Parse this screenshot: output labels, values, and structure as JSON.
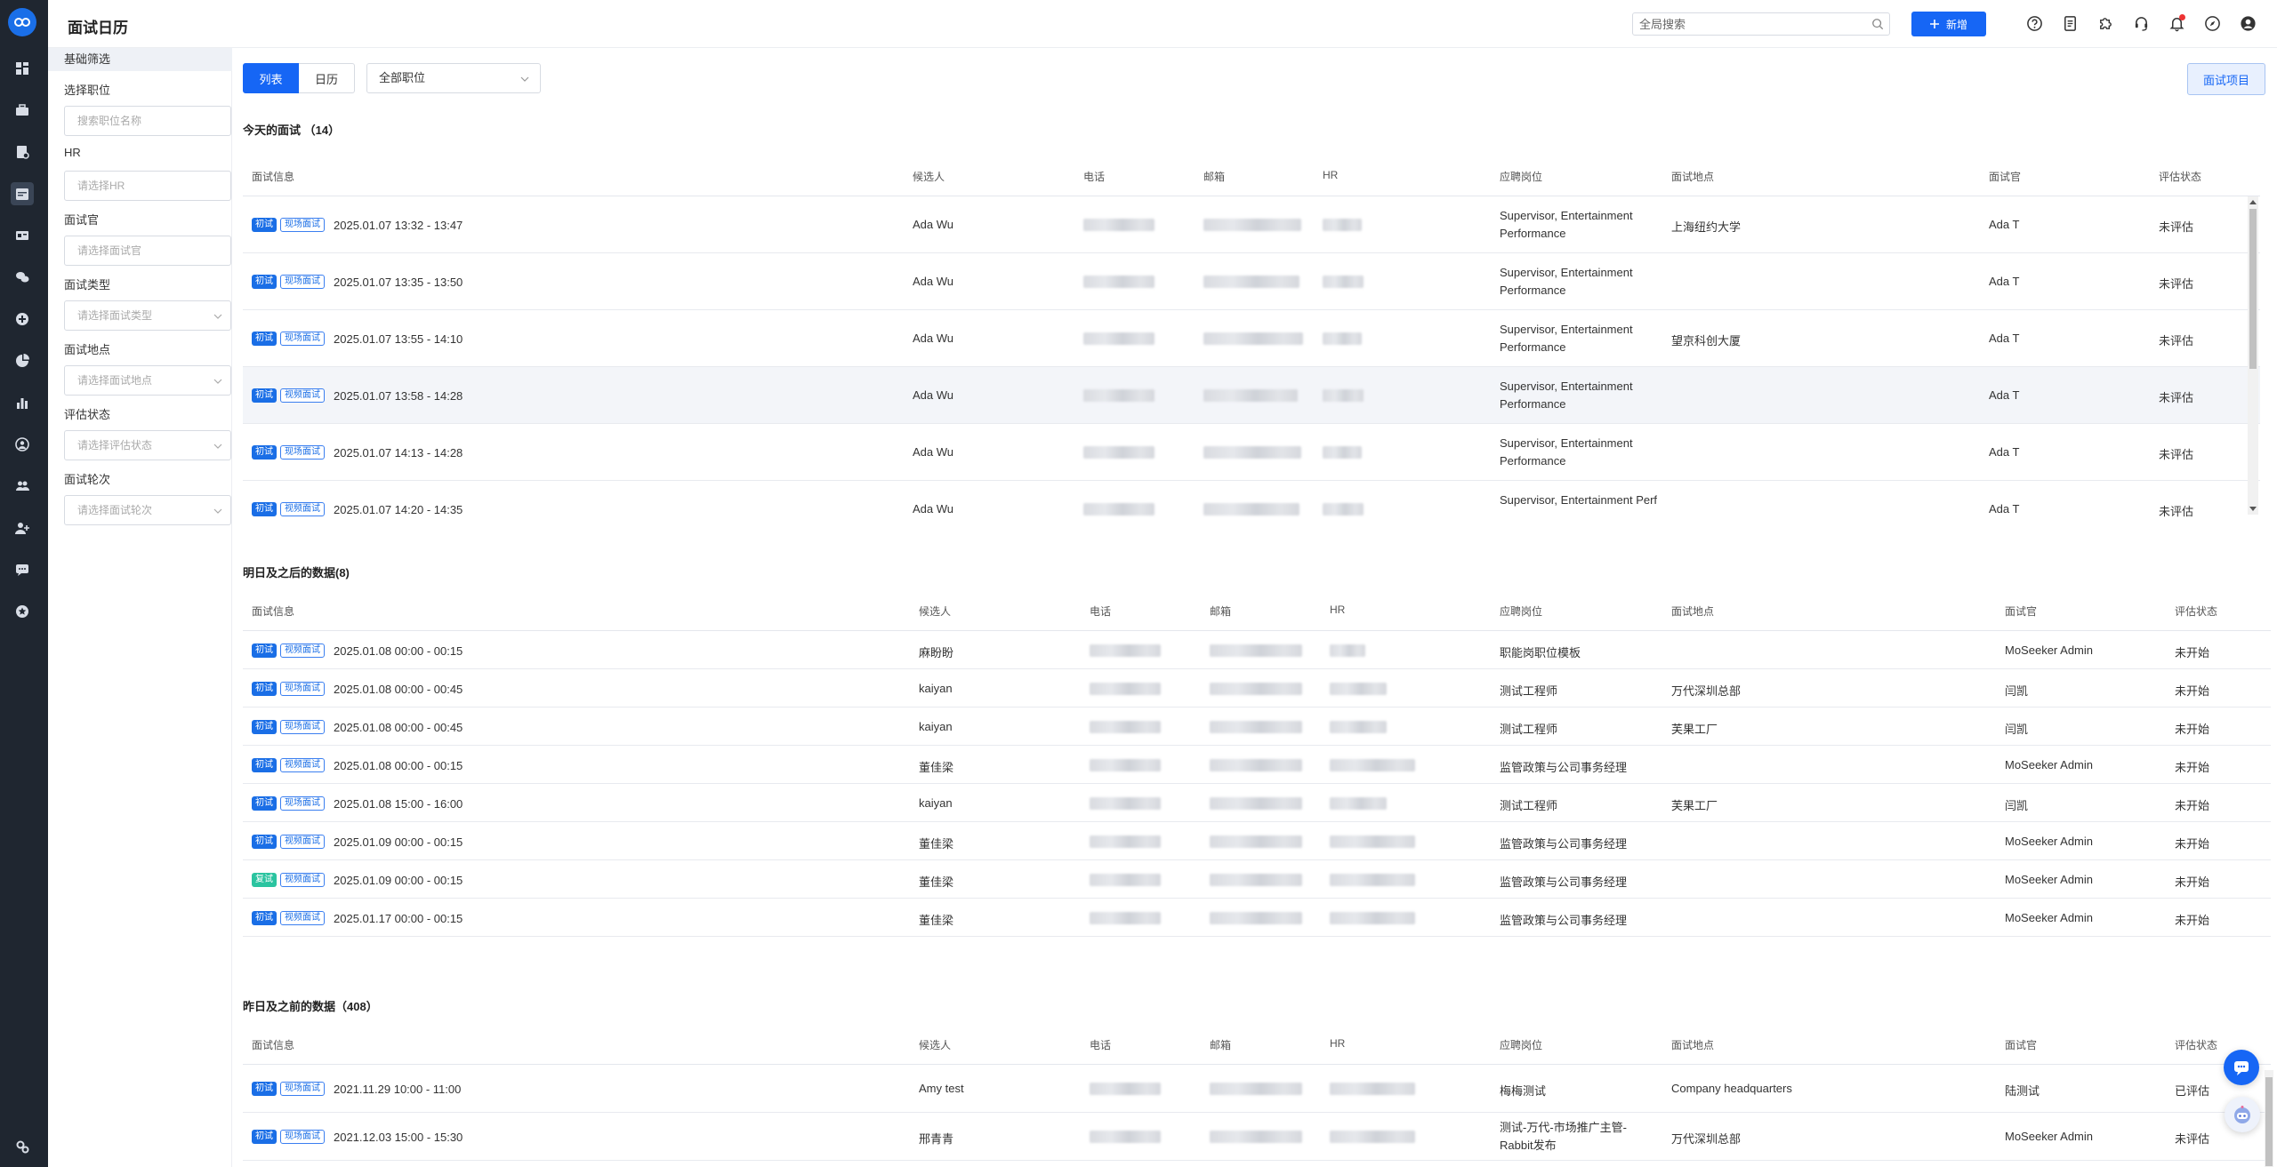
{
  "app": {
    "title": "面试日历"
  },
  "header": {
    "search_placeholder": "全局搜索",
    "new_label": "新增",
    "icons": [
      "help-icon",
      "document-icon",
      "puzzle-icon",
      "headset-icon",
      "bell-icon",
      "compass-icon",
      "user-icon"
    ]
  },
  "nav": {
    "items": [
      "dashboard-icon",
      "briefcase-icon",
      "resume-icon",
      "calendar-icon",
      "idcard-icon",
      "wechat-icon",
      "plus-circle-icon",
      "pie-chart-icon",
      "bar-chart-icon",
      "badge-icon",
      "users-icon",
      "user-add-icon",
      "message-icon",
      "star-icon",
      "settings-icon"
    ]
  },
  "filters": {
    "section": "基础筛选",
    "fields": [
      {
        "label": "选择职位",
        "placeholder": "搜索职位名称"
      },
      {
        "label": "HR",
        "placeholder": "请选择HR"
      },
      {
        "label": "面试官",
        "placeholder": "请选择面试官"
      },
      {
        "label": "面试类型",
        "placeholder": "请选择面试类型"
      },
      {
        "label": "面试地点",
        "placeholder": "请选择面试地点"
      },
      {
        "label": "评估状态",
        "placeholder": "请选择评估状态"
      },
      {
        "label": "面试轮次",
        "placeholder": "请选择面试轮次"
      }
    ]
  },
  "toolbar": {
    "tab_list": "列表",
    "tab_calendar": "日历",
    "position_select": "全部职位",
    "project_button": "面试项目"
  },
  "columns": [
    "面试信息",
    "候选人",
    "电话",
    "邮箱",
    "HR",
    "应聘岗位",
    "面试地点",
    "面试官",
    "评估状态"
  ],
  "today": {
    "title": "今天的面试 （14）",
    "rows": [
      {
        "round": "初试",
        "mode": "现场面试",
        "time": "2025.01.07 13:32 - 13:47",
        "candidate": "Ada Wu",
        "position": "Supervisor, Entertainment Performance",
        "location": "上海纽约大学",
        "interviewer": "Ada T",
        "status": "未评估"
      },
      {
        "round": "初试",
        "mode": "现场面试",
        "time": "2025.01.07 13:35 - 13:50",
        "candidate": "Ada Wu",
        "position": "Supervisor, Entertainment Performance",
        "location": "",
        "interviewer": "Ada T",
        "status": "未评估"
      },
      {
        "round": "初试",
        "mode": "现场面试",
        "time": "2025.01.07 13:55 - 14:10",
        "candidate": "Ada Wu",
        "position": "Supervisor, Entertainment Performance",
        "location": "望京科创大厦",
        "interviewer": "Ada T",
        "status": "未评估"
      },
      {
        "round": "初试",
        "mode": "视频面试",
        "time": "2025.01.07 13:58 - 14:28",
        "candidate": "Ada Wu",
        "position": "Supervisor, Entertainment Performance",
        "location": "",
        "interviewer": "Ada T",
        "status": "未评估"
      },
      {
        "round": "初试",
        "mode": "现场面试",
        "time": "2025.01.07 14:13 - 14:28",
        "candidate": "Ada Wu",
        "position": "Supervisor, Entertainment Performance",
        "location": "",
        "interviewer": "Ada T",
        "status": "未评估"
      },
      {
        "round": "初试",
        "mode": "视频面试",
        "time": "2025.01.07 14:20 - 14:35",
        "candidate": "Ada Wu",
        "position": "Supervisor, Entertainment Perf",
        "location": "",
        "interviewer": "Ada T",
        "status": "未评估"
      }
    ]
  },
  "future": {
    "title": "明日及之后的数据(8)",
    "rows": [
      {
        "round": "初试",
        "mode": "视频面试",
        "time": "2025.01.08 00:00 - 00:15",
        "candidate": "麻盼盼",
        "position": "职能岗职位模板",
        "location": "",
        "interviewer": "MoSeeker Admin",
        "status": "未开始"
      },
      {
        "round": "初试",
        "mode": "现场面试",
        "time": "2025.01.08 00:00 - 00:45",
        "candidate": "kaiyan",
        "position": "测试工程师",
        "location": "万代深圳总部",
        "interviewer": "闫凯",
        "status": "未开始"
      },
      {
        "round": "初试",
        "mode": "现场面试",
        "time": "2025.01.08 00:00 - 00:45",
        "candidate": "kaiyan",
        "position": "测试工程师",
        "location": "芙果工厂",
        "interviewer": "闫凯",
        "status": "未开始"
      },
      {
        "round": "初试",
        "mode": "视频面试",
        "time": "2025.01.08 00:00 - 00:15",
        "candidate": "董佳梁",
        "position": "监管政策与公司事务经理",
        "location": "",
        "interviewer": "MoSeeker Admin",
        "status": "未开始"
      },
      {
        "round": "初试",
        "mode": "现场面试",
        "time": "2025.01.08 15:00 - 16:00",
        "candidate": "kaiyan",
        "position": "测试工程师",
        "location": "芙果工厂",
        "interviewer": "闫凯",
        "status": "未开始"
      },
      {
        "round": "初试",
        "mode": "视频面试",
        "time": "2025.01.09 00:00 - 00:15",
        "candidate": "董佳梁",
        "position": "监管政策与公司事务经理",
        "location": "",
        "interviewer": "MoSeeker Admin",
        "status": "未开始"
      },
      {
        "round": "复试",
        "mode": "视频面试",
        "time": "2025.01.09 00:00 - 00:15",
        "candidate": "董佳梁",
        "position": "监管政策与公司事务经理",
        "location": "",
        "interviewer": "MoSeeker Admin",
        "status": "未开始"
      },
      {
        "round": "初试",
        "mode": "视频面试",
        "time": "2025.01.17 00:00 - 00:15",
        "candidate": "董佳梁",
        "position": "监管政策与公司事务经理",
        "location": "",
        "interviewer": "MoSeeker Admin",
        "status": "未开始"
      }
    ]
  },
  "past": {
    "title": "昨日及之前的数据（408）",
    "rows": [
      {
        "round": "初试",
        "mode": "现场面试",
        "time": "2021.11.29 10:00 - 11:00",
        "candidate": "Amy test",
        "position": "梅梅测试",
        "location": "Company headquarters",
        "interviewer": "陆测试",
        "status": "已评估"
      },
      {
        "round": "初试",
        "mode": "现场面试",
        "time": "2021.12.03 15:00 - 15:30",
        "candidate": "邢青青",
        "position": "测试-万代-市场推广主管-Rabbit发布",
        "location": "万代深圳总部",
        "interviewer": "MoSeeker Admin",
        "status": "未评估"
      }
    ]
  }
}
